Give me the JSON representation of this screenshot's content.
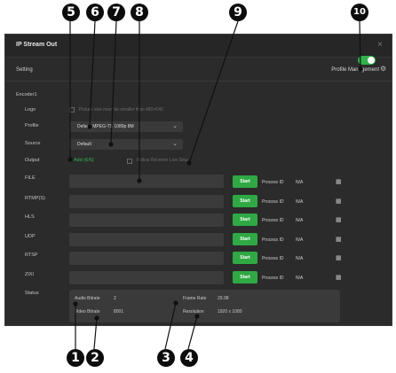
{
  "window": {
    "title": "IP Stream Out",
    "close_glyph": "×",
    "setting_label": "Setting",
    "profile_management": "Profile Management",
    "gear_icon": "gear-icon"
  },
  "encoder": {
    "label": "Encoder1",
    "enabled": true,
    "logo": {
      "label": "Logo",
      "hint": "Picture size must be smaller than 480×640"
    },
    "profile": {
      "label": "Profile",
      "value": "Default MPEG-TS 1080p 8M"
    },
    "source": {
      "label": "Source",
      "value": "Default"
    },
    "output": {
      "label": "Output",
      "add_text": "Add (6/6)",
      "follow_text": "Follow Receiver Live Stop"
    }
  },
  "outputs": [
    {
      "label": "FILE",
      "button": "Start",
      "process_label": "Process ID",
      "process_value": "N/A",
      "icon": "▦"
    },
    {
      "label": "RTMP(S)",
      "button": "Start",
      "process_label": "Process ID",
      "process_value": "N/A",
      "icon": "▦"
    },
    {
      "label": "HLS",
      "button": "Start",
      "process_label": "Process ID",
      "process_value": "N/A",
      "icon": "▦"
    },
    {
      "label": "UDP",
      "button": "Start",
      "process_label": "Process ID",
      "process_value": "N/A",
      "icon": "▦"
    },
    {
      "label": "RTSP",
      "button": "Start",
      "process_label": "Process ID",
      "process_value": "N/A",
      "icon": "▦"
    },
    {
      "label": "ZIXI",
      "button": "Start",
      "process_label": "Process ID",
      "process_value": "N/A",
      "icon": "▦"
    }
  ],
  "status": {
    "label": "Status",
    "audio_bitrate_label": "Audio Bitrate",
    "audio_bitrate_value": "2",
    "video_bitrate_label": "Video Bitrate",
    "video_bitrate_value": "8001",
    "frame_rate_label": "Frame Rate",
    "frame_rate_value": "29.98",
    "resolution_label": "Resolution",
    "resolution_value": "1920 x 1080"
  },
  "callouts": [
    "1",
    "2",
    "3",
    "4",
    "5",
    "6",
    "7",
    "8",
    "9",
    "10"
  ],
  "colors": {
    "accent_green": "#2fa944",
    "panel_bg": "#2b2b2b",
    "field_bg": "#3b3b3b"
  }
}
